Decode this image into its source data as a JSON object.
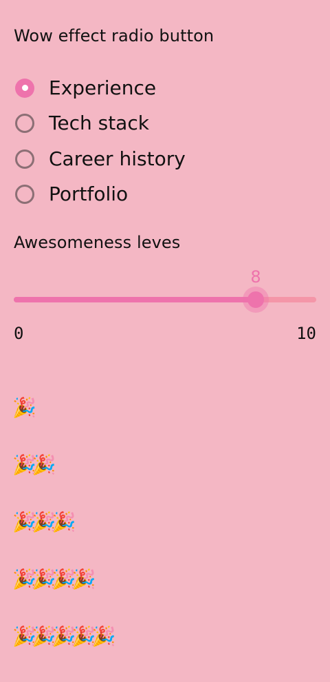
{
  "radio_section": {
    "title": "Wow effect radio button",
    "options": [
      {
        "label": "Experience",
        "checked": true
      },
      {
        "label": "Tech stack",
        "checked": false
      },
      {
        "label": "Career history",
        "checked": false
      },
      {
        "label": "Portfolio",
        "checked": false
      }
    ]
  },
  "slider_section": {
    "title": "Awesomeness leves",
    "value": 8,
    "value_text": "8",
    "min": 0,
    "max": 10,
    "min_label": "0",
    "max_label": "10"
  },
  "party_rows": [
    "🎉",
    "🎉🎉",
    "🎉🎉🎉",
    "🎉🎉🎉🎉",
    "🎉🎉🎉🎉🎉"
  ],
  "colors": {
    "background": "#f4b7c4",
    "accent": "#ee73ac",
    "track_inactive": "#f496a8",
    "radio_border": "#8c6f75"
  },
  "icons": {
    "party": "party-popper-icon"
  }
}
